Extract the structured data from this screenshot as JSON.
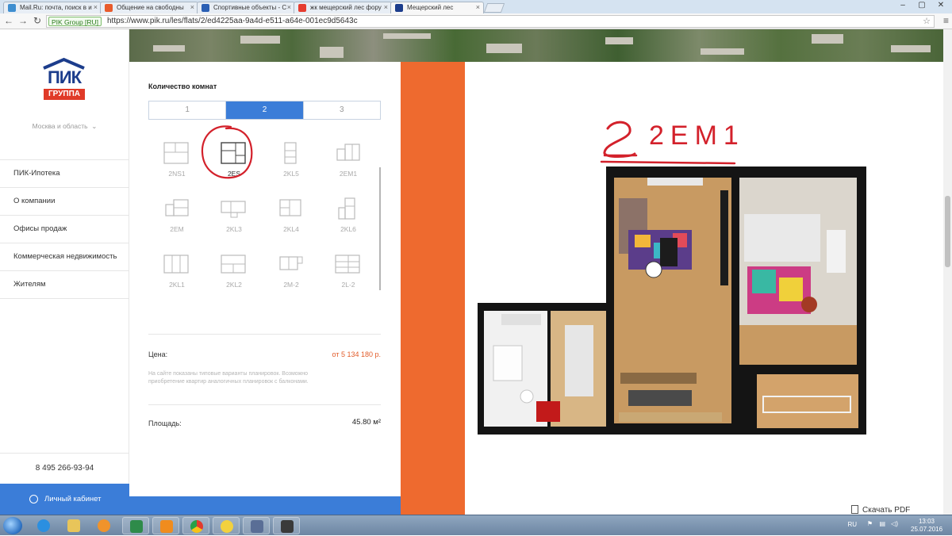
{
  "browser": {
    "tabs": [
      {
        "title": "Mail.Ru: почта, поиск в и",
        "fav_color": "#3e8ed0"
      },
      {
        "title": "Общение на свободны",
        "fav_color": "#e85b2c"
      },
      {
        "title": "Спортивные объекты - С",
        "fav_color": "#2a5fb4"
      },
      {
        "title": "жк мещерский лес фору",
        "fav_color": "#e63c2f"
      },
      {
        "title": "Мещерский лес",
        "fav_color": "#1c3d8c"
      }
    ],
    "ev_badge": "PIK Group [RU]",
    "url": "https://www.pik.ru/les/flats/2/ed4225aa-9a4d-e511-a64e-001ec9d5643c"
  },
  "sidebar": {
    "logo_top": "ПИК",
    "logo_bottom": "ГРУППА",
    "region": "Москва и область",
    "menu": [
      "ПИК-Ипотека",
      "О компании",
      "Офисы продаж",
      "Коммерческая недвижимость",
      "Жителям"
    ],
    "phone": "8 495 266-93-94",
    "cabinet": "Личный кабинет"
  },
  "filter": {
    "rooms_label": "Количество комнат",
    "room_options": [
      "1",
      "2",
      "3"
    ],
    "selected_room": "2"
  },
  "layouts": [
    {
      "code": "2NS1",
      "active": false
    },
    {
      "code": "2ES",
      "active": true
    },
    {
      "code": "2KL5",
      "active": false
    },
    {
      "code": "2EM1",
      "active": false
    },
    {
      "code": "2EM",
      "active": false
    },
    {
      "code": "2KL3",
      "active": false
    },
    {
      "code": "2KL4",
      "active": false
    },
    {
      "code": "2KL6",
      "active": false
    },
    {
      "code": "2KL1",
      "active": false
    },
    {
      "code": "2KL2",
      "active": false
    },
    {
      "code": "2M-2",
      "active": false
    },
    {
      "code": "2L-2",
      "active": false
    }
  ],
  "details": {
    "price_label": "Цена:",
    "price_value": "от 5 134 180 р.",
    "note": "На сайте показаны типовые варианты планировок. Возможно приобретение квартир аналогичных планировок с балконами.",
    "area_label": "Площадь:",
    "area_value": "45.80 м²"
  },
  "plan": {
    "annotation": "2EM1",
    "download": "Скачать PDF"
  },
  "taskbar": {
    "lang": "RU",
    "time": "13:03",
    "date": "25.07.2016"
  },
  "colors": {
    "accent_blue": "#3b7dd8",
    "orange_band": "#ee6a2f",
    "price_orange": "#e25c2a",
    "annotation_red": "#d3212b"
  }
}
